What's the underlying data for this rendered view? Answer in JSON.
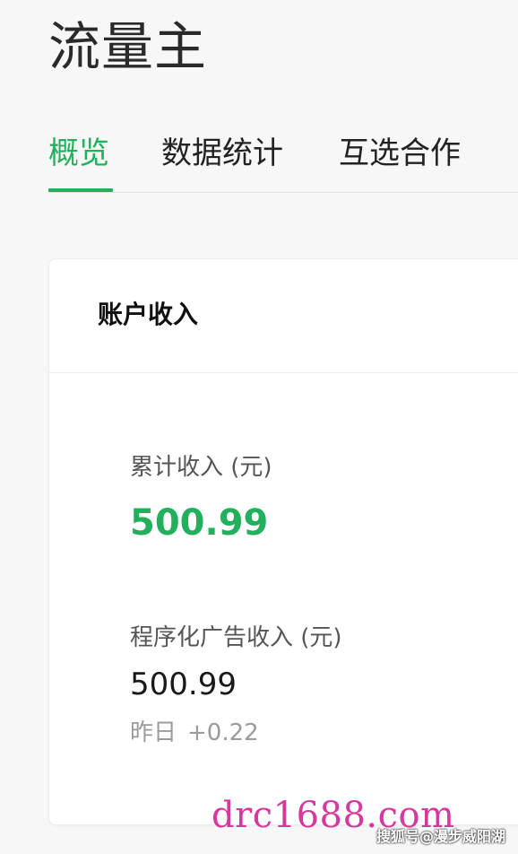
{
  "header": {
    "title": "流量主"
  },
  "tabs": [
    {
      "label": "概览",
      "active": true
    },
    {
      "label": "数据统计",
      "active": false
    },
    {
      "label": "互选合作",
      "active": false
    }
  ],
  "account_income": {
    "title": "账户收入",
    "cumulative_label": "累计收入 (元)",
    "cumulative_value": "500.99",
    "programmatic_label": "程序化广告收入 (元)",
    "programmatic_value": "500.99",
    "yesterday_label": "昨日",
    "yesterday_delta": "+0.22"
  },
  "watermark": {
    "text": "drc1688.com",
    "credit": "搜狐号@漫步威阳湖"
  },
  "colors": {
    "accent": "#22b05d",
    "background": "#f7f7f7",
    "card": "#ffffff",
    "watermark": "#d22896"
  }
}
